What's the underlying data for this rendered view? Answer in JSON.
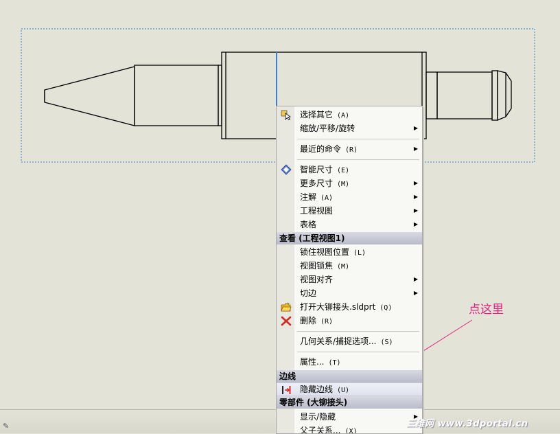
{
  "menu": {
    "items": [
      {
        "label": "选择其它",
        "accel": "(A)",
        "submenu": false,
        "icon": "select-other-icon"
      },
      {
        "label": "缩放/平移/旋转",
        "accel": "",
        "submenu": true,
        "icon": ""
      },
      {
        "label": "最近的命令",
        "accel": "(R)",
        "submenu": true,
        "icon": ""
      },
      {
        "label": "智能尺寸",
        "accel": "(E)",
        "submenu": false,
        "icon": "smart-dimension-icon"
      },
      {
        "label": "更多尺寸",
        "accel": "(M)",
        "submenu": true,
        "icon": ""
      },
      {
        "label": "注解",
        "accel": "(A)",
        "submenu": true,
        "icon": ""
      },
      {
        "label": "工程视图",
        "accel": "",
        "submenu": true,
        "icon": ""
      },
      {
        "label": "表格",
        "accel": "",
        "submenu": true,
        "icon": ""
      }
    ],
    "section_view": "查看 (工程视图1)",
    "view_items": [
      {
        "label": "锁住视图位置",
        "accel": "(L)",
        "submenu": false
      },
      {
        "label": "视图锁焦",
        "accel": "(M)",
        "submenu": false
      },
      {
        "label": "视图对齐",
        "accel": "",
        "submenu": true
      },
      {
        "label": "切边",
        "accel": "",
        "submenu": true
      },
      {
        "label": "打开大铆接头.sldprt",
        "accel": "(Q)",
        "submenu": false,
        "icon": "open-folder-icon"
      },
      {
        "label": "删除",
        "accel": "(R)",
        "submenu": false,
        "icon": "delete-icon"
      },
      {
        "label": "几何关系/捕捉选项...",
        "accel": "(S)",
        "submenu": false
      },
      {
        "label": "属性...",
        "accel": "(T)",
        "submenu": false
      }
    ],
    "section_edge": "边线",
    "hide_edge": {
      "label": "隐藏边线",
      "accel": "(U)"
    },
    "section_part": "零部件 (大铆接头)",
    "part_items": [
      {
        "label": "显示/隐藏",
        "accel": "",
        "submenu": true
      },
      {
        "label": "父子关系...",
        "accel": "(X)",
        "submenu": false
      }
    ]
  },
  "annotation": "点这里",
  "watermark": "三维网 www.3dportal.cn",
  "colors": {
    "annotation": "#e0207f",
    "selection_box": "#3b7fd0",
    "background": "#e4e3d8"
  }
}
